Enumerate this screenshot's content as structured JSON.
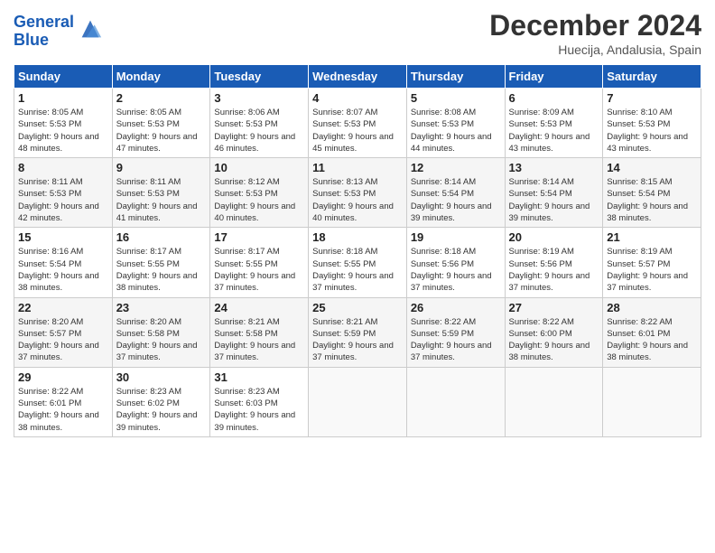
{
  "logo": {
    "line1": "General",
    "line2": "Blue"
  },
  "title": {
    "month_year": "December 2024",
    "location": "Huecija, Andalusia, Spain"
  },
  "days_of_week": [
    "Sunday",
    "Monday",
    "Tuesday",
    "Wednesday",
    "Thursday",
    "Friday",
    "Saturday"
  ],
  "weeks": [
    [
      {
        "day": 1,
        "sunrise": "8:05 AM",
        "sunset": "5:53 PM",
        "daylight": "9 hours and 48 minutes."
      },
      {
        "day": 2,
        "sunrise": "8:05 AM",
        "sunset": "5:53 PM",
        "daylight": "9 hours and 47 minutes."
      },
      {
        "day": 3,
        "sunrise": "8:06 AM",
        "sunset": "5:53 PM",
        "daylight": "9 hours and 46 minutes."
      },
      {
        "day": 4,
        "sunrise": "8:07 AM",
        "sunset": "5:53 PM",
        "daylight": "9 hours and 45 minutes."
      },
      {
        "day": 5,
        "sunrise": "8:08 AM",
        "sunset": "5:53 PM",
        "daylight": "9 hours and 44 minutes."
      },
      {
        "day": 6,
        "sunrise": "8:09 AM",
        "sunset": "5:53 PM",
        "daylight": "9 hours and 43 minutes."
      },
      {
        "day": 7,
        "sunrise": "8:10 AM",
        "sunset": "5:53 PM",
        "daylight": "9 hours and 43 minutes."
      }
    ],
    [
      {
        "day": 8,
        "sunrise": "8:11 AM",
        "sunset": "5:53 PM",
        "daylight": "9 hours and 42 minutes."
      },
      {
        "day": 9,
        "sunrise": "8:11 AM",
        "sunset": "5:53 PM",
        "daylight": "9 hours and 41 minutes."
      },
      {
        "day": 10,
        "sunrise": "8:12 AM",
        "sunset": "5:53 PM",
        "daylight": "9 hours and 40 minutes."
      },
      {
        "day": 11,
        "sunrise": "8:13 AM",
        "sunset": "5:53 PM",
        "daylight": "9 hours and 40 minutes."
      },
      {
        "day": 12,
        "sunrise": "8:14 AM",
        "sunset": "5:54 PM",
        "daylight": "9 hours and 39 minutes."
      },
      {
        "day": 13,
        "sunrise": "8:14 AM",
        "sunset": "5:54 PM",
        "daylight": "9 hours and 39 minutes."
      },
      {
        "day": 14,
        "sunrise": "8:15 AM",
        "sunset": "5:54 PM",
        "daylight": "9 hours and 38 minutes."
      }
    ],
    [
      {
        "day": 15,
        "sunrise": "8:16 AM",
        "sunset": "5:54 PM",
        "daylight": "9 hours and 38 minutes."
      },
      {
        "day": 16,
        "sunrise": "8:17 AM",
        "sunset": "5:55 PM",
        "daylight": "9 hours and 38 minutes."
      },
      {
        "day": 17,
        "sunrise": "8:17 AM",
        "sunset": "5:55 PM",
        "daylight": "9 hours and 37 minutes."
      },
      {
        "day": 18,
        "sunrise": "8:18 AM",
        "sunset": "5:55 PM",
        "daylight": "9 hours and 37 minutes."
      },
      {
        "day": 19,
        "sunrise": "8:18 AM",
        "sunset": "5:56 PM",
        "daylight": "9 hours and 37 minutes."
      },
      {
        "day": 20,
        "sunrise": "8:19 AM",
        "sunset": "5:56 PM",
        "daylight": "9 hours and 37 minutes."
      },
      {
        "day": 21,
        "sunrise": "8:19 AM",
        "sunset": "5:57 PM",
        "daylight": "9 hours and 37 minutes."
      }
    ],
    [
      {
        "day": 22,
        "sunrise": "8:20 AM",
        "sunset": "5:57 PM",
        "daylight": "9 hours and 37 minutes."
      },
      {
        "day": 23,
        "sunrise": "8:20 AM",
        "sunset": "5:58 PM",
        "daylight": "9 hours and 37 minutes."
      },
      {
        "day": 24,
        "sunrise": "8:21 AM",
        "sunset": "5:58 PM",
        "daylight": "9 hours and 37 minutes."
      },
      {
        "day": 25,
        "sunrise": "8:21 AM",
        "sunset": "5:59 PM",
        "daylight": "9 hours and 37 minutes."
      },
      {
        "day": 26,
        "sunrise": "8:22 AM",
        "sunset": "5:59 PM",
        "daylight": "9 hours and 37 minutes."
      },
      {
        "day": 27,
        "sunrise": "8:22 AM",
        "sunset": "6:00 PM",
        "daylight": "9 hours and 38 minutes."
      },
      {
        "day": 28,
        "sunrise": "8:22 AM",
        "sunset": "6:01 PM",
        "daylight": "9 hours and 38 minutes."
      }
    ],
    [
      {
        "day": 29,
        "sunrise": "8:22 AM",
        "sunset": "6:01 PM",
        "daylight": "9 hours and 38 minutes."
      },
      {
        "day": 30,
        "sunrise": "8:23 AM",
        "sunset": "6:02 PM",
        "daylight": "9 hours and 39 minutes."
      },
      {
        "day": 31,
        "sunrise": "8:23 AM",
        "sunset": "6:03 PM",
        "daylight": "9 hours and 39 minutes."
      },
      null,
      null,
      null,
      null
    ]
  ]
}
